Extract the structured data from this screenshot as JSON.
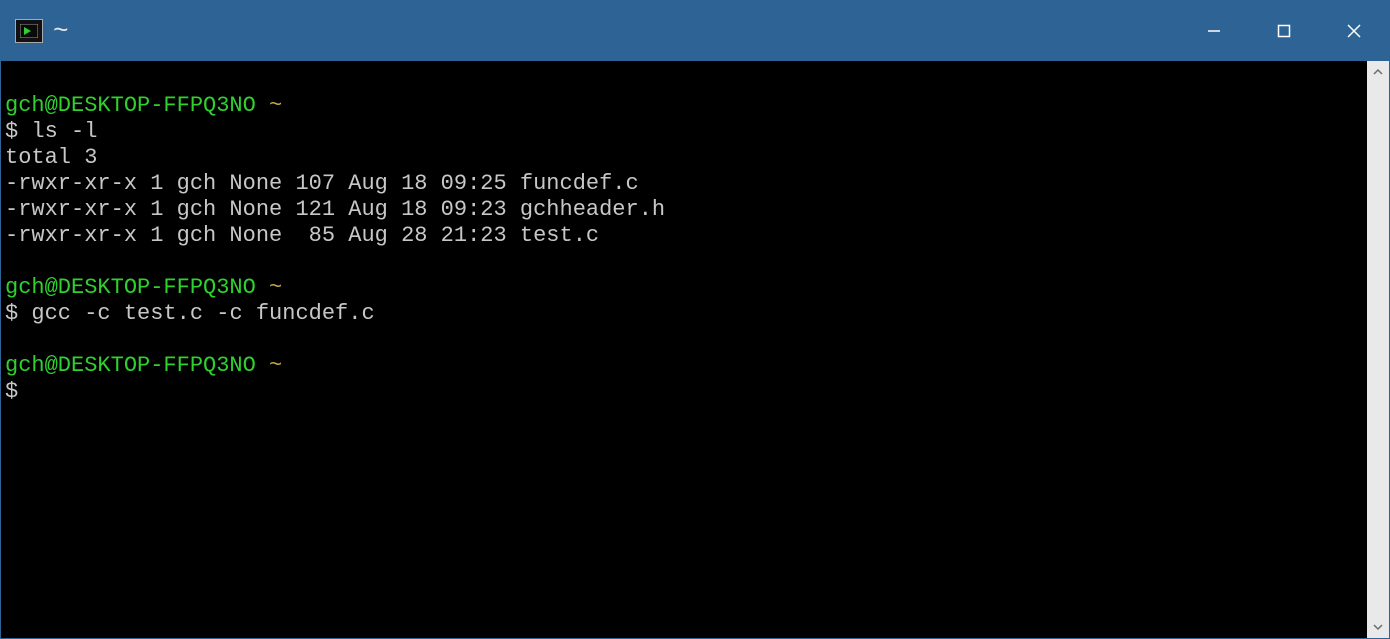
{
  "window": {
    "title": "~"
  },
  "terminal": {
    "blocks": [
      {
        "prompt_host": "gch@DESKTOP-FFPQ3NO",
        "prompt_path": "~",
        "prompt_symbol": "$",
        "command": "ls -l",
        "output": "total 3\n-rwxr-xr-x 1 gch None 107 Aug 18 09:25 funcdef.c\n-rwxr-xr-x 1 gch None 121 Aug 18 09:23 gchheader.h\n-rwxr-xr-x 1 gch None  85 Aug 28 21:23 test.c"
      },
      {
        "prompt_host": "gch@DESKTOP-FFPQ3NO",
        "prompt_path": "~",
        "prompt_symbol": "$",
        "command": "gcc -c test.c -c funcdef.c",
        "output": ""
      },
      {
        "prompt_host": "gch@DESKTOP-FFPQ3NO",
        "prompt_path": "~",
        "prompt_symbol": "$",
        "command": "",
        "output": ""
      }
    ]
  }
}
